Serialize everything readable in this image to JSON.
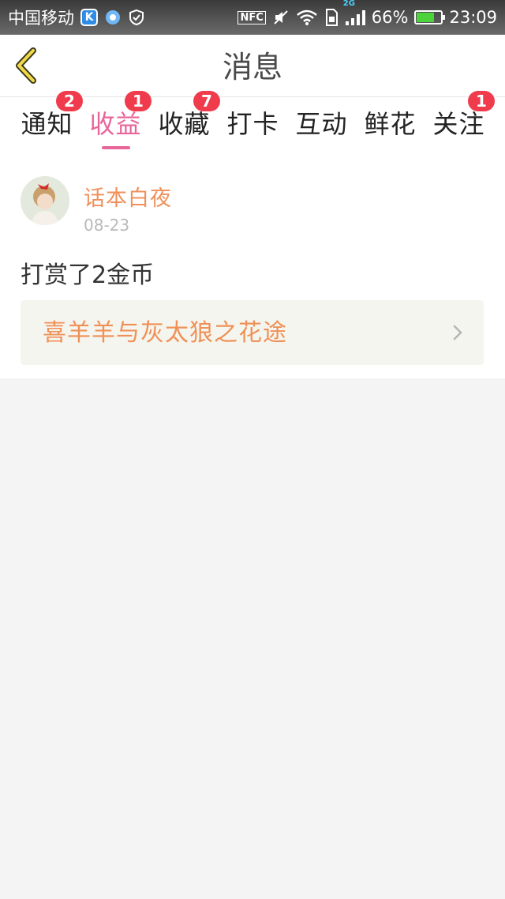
{
  "status_bar": {
    "carrier": "中国移动",
    "k_label": "K",
    "nfc": "NFC",
    "network": "2G",
    "battery": "66%",
    "time": "23:09"
  },
  "header": {
    "title": "消息",
    "back_icon": "back-chevron-icon"
  },
  "tabs": [
    {
      "label": "通知",
      "badge": "2"
    },
    {
      "label": "收益",
      "badge": "1",
      "active": true
    },
    {
      "label": "收藏",
      "badge": "7"
    },
    {
      "label": "打卡",
      "badge": ""
    },
    {
      "label": "互动",
      "badge": ""
    },
    {
      "label": "鲜花",
      "badge": ""
    },
    {
      "label": "关注",
      "badge": "1"
    }
  ],
  "message": {
    "sender": "话本白夜",
    "date": "08-23",
    "text": "打赏了2金币",
    "book_title": "喜羊羊与灰太狼之花途"
  },
  "colors": {
    "accent": "#e8659a",
    "badge": "#ef3b4b",
    "sender": "#f0905a",
    "book_title": "#ef9157",
    "background": "#f4f4f4"
  }
}
